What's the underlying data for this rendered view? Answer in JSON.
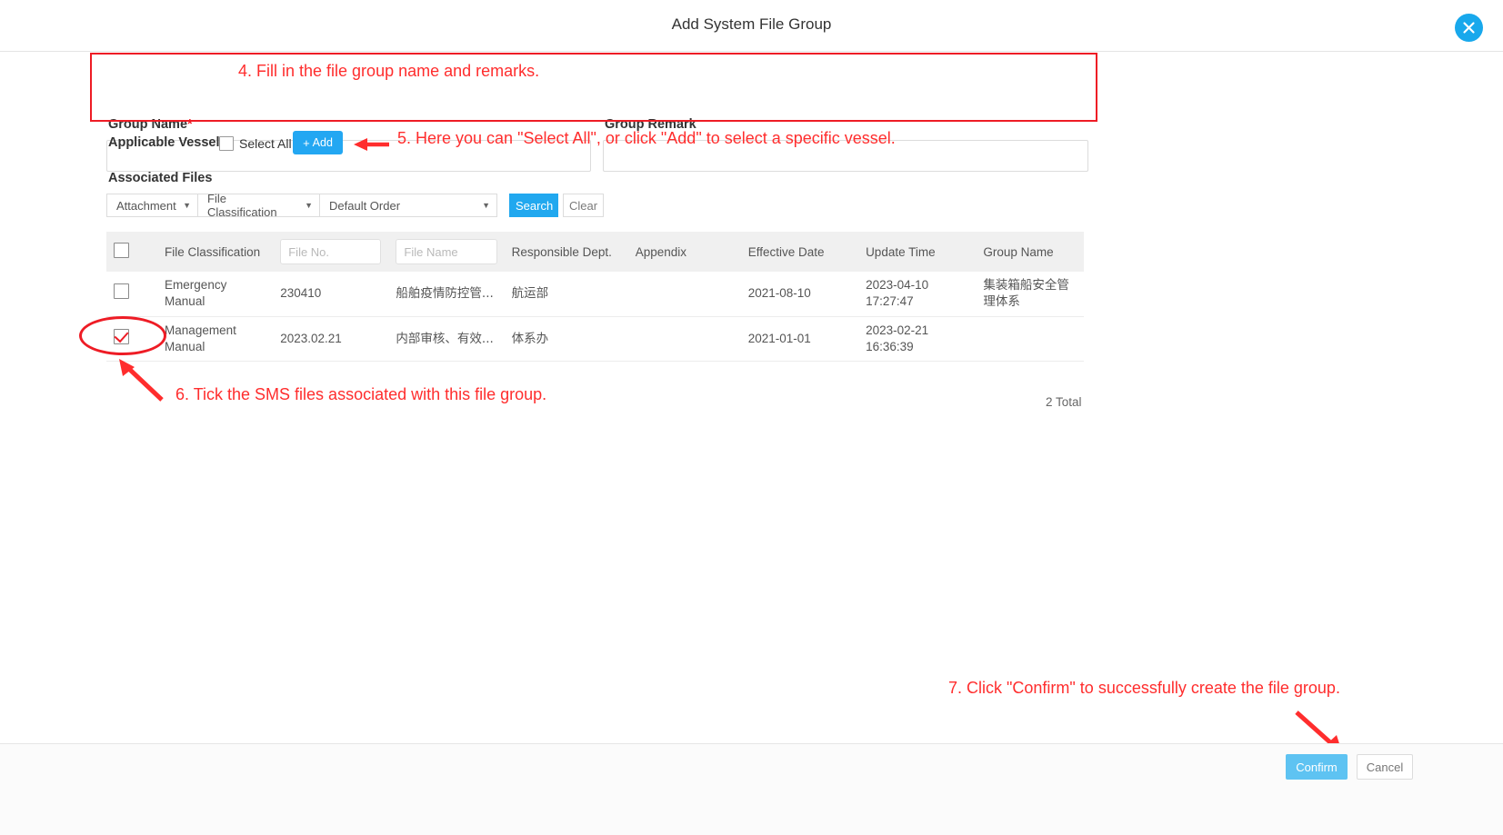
{
  "dialog": {
    "title": "Add System File Group",
    "close_icon": "close-circle-icon"
  },
  "form": {
    "group_name_label": "Group Name",
    "group_name_required_mark": "*",
    "group_name_value": "",
    "group_name_placeholder": "",
    "group_remark_label": "Group Remark",
    "group_remark_value": "",
    "group_remark_placeholder": ""
  },
  "vessels": {
    "label": "Applicable Vessels",
    "select_all_label": "Select All",
    "select_all_checked": false,
    "add_button_label": "Add",
    "add_button_icon": "plus-icon"
  },
  "associated": {
    "title": "Associated Files",
    "filters": {
      "attachment": "Attachment",
      "classification": "File Classification",
      "order": "Default Order"
    },
    "search_label": "Search",
    "clear_label": "Clear"
  },
  "table": {
    "headers": {
      "select": "",
      "file_classification": "File Classification",
      "file_no_placeholder": "File No.",
      "file_no_value": "",
      "file_name_placeholder": "File Name",
      "file_name_value": "",
      "responsible_dept": "Responsible Dept.",
      "appendix": "Appendix",
      "effective_date": "Effective Date",
      "update_time": "Update Time",
      "group_name": "Group Name"
    },
    "rows": [
      {
        "checked": false,
        "file_classification": "Emergency Manual",
        "file_no": "230410",
        "file_name": "船舶疫情防控管...",
        "responsible_dept": "航运部",
        "appendix": "",
        "effective_date": "2021-08-10",
        "update_time": "2023-04-10 17:27:47",
        "group_name": "集装箱船安全管理体系"
      },
      {
        "checked": true,
        "file_classification": "Management Manual",
        "file_no": "2023.02.21",
        "file_name": "内部审核、有效...",
        "responsible_dept": "体系办",
        "appendix": "",
        "effective_date": "2021-01-01",
        "update_time": "2023-02-21 16:36:39",
        "group_name": ""
      }
    ],
    "total_text": "2 Total"
  },
  "footer": {
    "confirm_label": "Confirm",
    "cancel_label": "Cancel"
  },
  "annotations": {
    "step4": "4. Fill in the file group name and remarks.",
    "step5": "5. Here you can \"Select All\", or click \"Add\" to select a specific vessel.",
    "step6": "6. Tick the SMS files associated with this file group.",
    "step7": "7. Click \"Confirm\" to successfully create the file group.",
    "color": "#ff2d2d"
  }
}
